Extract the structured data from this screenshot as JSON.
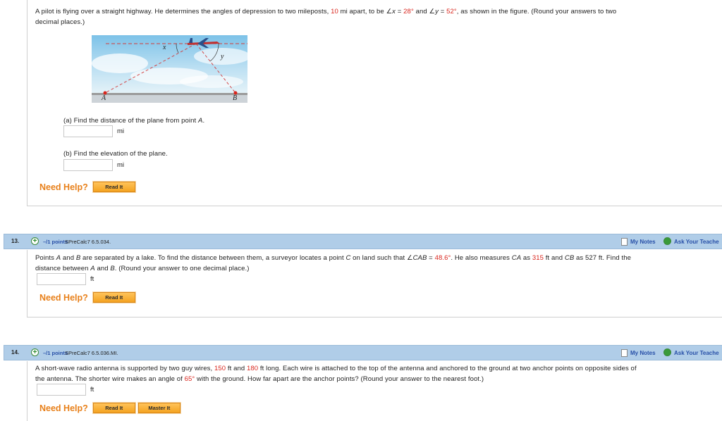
{
  "q12": {
    "text_parts": [
      "A pilot is flying over a straight highway. He determines the angles of depression to two mileposts, ",
      "10",
      " mi apart, to be ",
      "∠x",
      " = ",
      "28°",
      " and ",
      "∠y",
      " = ",
      "52°",
      ", as shown in the figure. (Round your answers to two",
      "decimal places.)"
    ],
    "figure": {
      "label_x": "x",
      "label_y": "y",
      "label_a": "A",
      "label_b": "B"
    },
    "part_a": {
      "prefix": "(a) Find the distance of the plane from point ",
      "point": "A",
      "suffix": ".",
      "unit": "mi",
      "value": ""
    },
    "part_b": {
      "label": "(b) Find the elevation of the plane.",
      "unit": "mi",
      "value": ""
    },
    "help": {
      "label": "Need Help?",
      "read_it": "Read It"
    }
  },
  "q13": {
    "number": "13.",
    "plus": "+",
    "points": "–/1 points",
    "code": "SPreCalc7 6.5.034.",
    "my_notes": "My Notes",
    "ask_teacher": "Ask Your Teache",
    "text_a": "Points ",
    "text_b": "A",
    "text_c": " and ",
    "text_d": "B",
    "text_e": " are separated by a lake. To find the distance between them, a surveyor locates a point ",
    "text_f": "C",
    "text_g": " on land such that ∠",
    "text_h": "CAB",
    "text_i": " = ",
    "text_j": "48.6°",
    "text_k": ". He also measures ",
    "text_l": "CA",
    "text_m": " as ",
    "text_n": "315",
    "text_o": " ft and ",
    "text_p": "CB",
    "text_q": " as 527 ft. Find the",
    "line2_a": "distance between ",
    "line2_b": "A",
    "line2_c": " and ",
    "line2_d": "B",
    "line2_e": ". (Round your answer to one decimal place.)",
    "unit": "ft",
    "value": "",
    "help": {
      "label": "Need Help?",
      "read_it": "Read It"
    }
  },
  "q14": {
    "number": "14.",
    "plus": "+",
    "points": "–/1 points",
    "code": "SPreCalc7 6.5.036.MI.",
    "my_notes": "My Notes",
    "ask_teacher": "Ask Your Teache",
    "line1_a": "A short-wave radio antenna is supported by two guy wires, ",
    "line1_b": "150",
    "line1_c": " ft and ",
    "line1_d": "180",
    "line1_e": " ft long. Each wire is attached to the top of the antenna and anchored to the ground at two anchor points on opposite sides of",
    "line2_a": "the antenna. The shorter wire makes an angle of ",
    "line2_b": "65°",
    "line2_c": " with the ground. How far apart are the anchor points? (Round your answer to the nearest foot.)",
    "unit": "ft",
    "value": "",
    "help": {
      "label": "Need Help?",
      "read_it": "Read It",
      "master_it": "Master It"
    }
  },
  "colors": {
    "header_bg": "#b0cde8",
    "link": "#2850a8",
    "help_orange": "#e8801a",
    "highlight_red": "#d9251d"
  }
}
